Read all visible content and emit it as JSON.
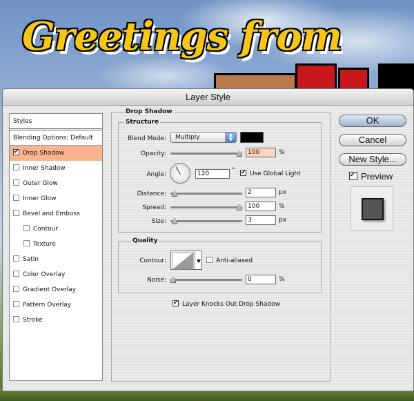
{
  "background": {
    "greeting": "Greetings from"
  },
  "window": {
    "title": "Layer Style"
  },
  "styles_panel": {
    "header": "Styles",
    "blending": "Blending Options: Default",
    "items": [
      {
        "label": "Drop Shadow",
        "checked": true,
        "selected": true,
        "sub": false
      },
      {
        "label": "Inner Shadow",
        "checked": false,
        "selected": false,
        "sub": false
      },
      {
        "label": "Outer Glow",
        "checked": false,
        "selected": false,
        "sub": false
      },
      {
        "label": "Inner Glow",
        "checked": false,
        "selected": false,
        "sub": false
      },
      {
        "label": "Bevel and Emboss",
        "checked": false,
        "selected": false,
        "sub": false
      },
      {
        "label": "Contour",
        "checked": false,
        "selected": false,
        "sub": true
      },
      {
        "label": "Texture",
        "checked": false,
        "selected": false,
        "sub": true
      },
      {
        "label": "Satin",
        "checked": false,
        "selected": false,
        "sub": false
      },
      {
        "label": "Color Overlay",
        "checked": false,
        "selected": false,
        "sub": false
      },
      {
        "label": "Gradient Overlay",
        "checked": false,
        "selected": false,
        "sub": false
      },
      {
        "label": "Pattern Overlay",
        "checked": false,
        "selected": false,
        "sub": false
      },
      {
        "label": "Stroke",
        "checked": false,
        "selected": false,
        "sub": false
      }
    ]
  },
  "drop_shadow": {
    "title": "Drop Shadow",
    "structure": {
      "title": "Structure",
      "blend_mode_label": "Blend Mode:",
      "blend_mode_value": "Multiply",
      "shadow_color": "#000000",
      "opacity_label": "Opacity:",
      "opacity_value": "100",
      "opacity_unit": "%",
      "opacity_level": 1.0,
      "angle_label": "Angle:",
      "angle_value": "120",
      "angle_unit": "°",
      "use_global_light_label": "Use Global Light",
      "use_global_light": true,
      "distance_label": "Distance:",
      "distance_value": "2",
      "distance_unit": "px",
      "distance_level": 0.02,
      "spread_label": "Spread:",
      "spread_value": "100",
      "spread_unit": "%",
      "spread_level": 1.0,
      "size_label": "Size:",
      "size_value": "3",
      "size_unit": "px",
      "size_level": 0.02
    },
    "quality": {
      "title": "Quality",
      "contour_label": "Contour:",
      "anti_aliased_label": "Anti-aliased",
      "anti_aliased": false,
      "noise_label": "Noise:",
      "noise_value": "0",
      "noise_unit": "%",
      "noise_level": 0.0
    },
    "knockout_label": "Layer Knocks Out Drop Shadow",
    "knockout": true
  },
  "buttons": {
    "ok": "OK",
    "cancel": "Cancel",
    "new_style": "New Style...",
    "preview_label": "Preview",
    "preview_checked": true
  },
  "colors": {
    "selected_row": "#fdb48e",
    "greeting": "#f5c518"
  }
}
